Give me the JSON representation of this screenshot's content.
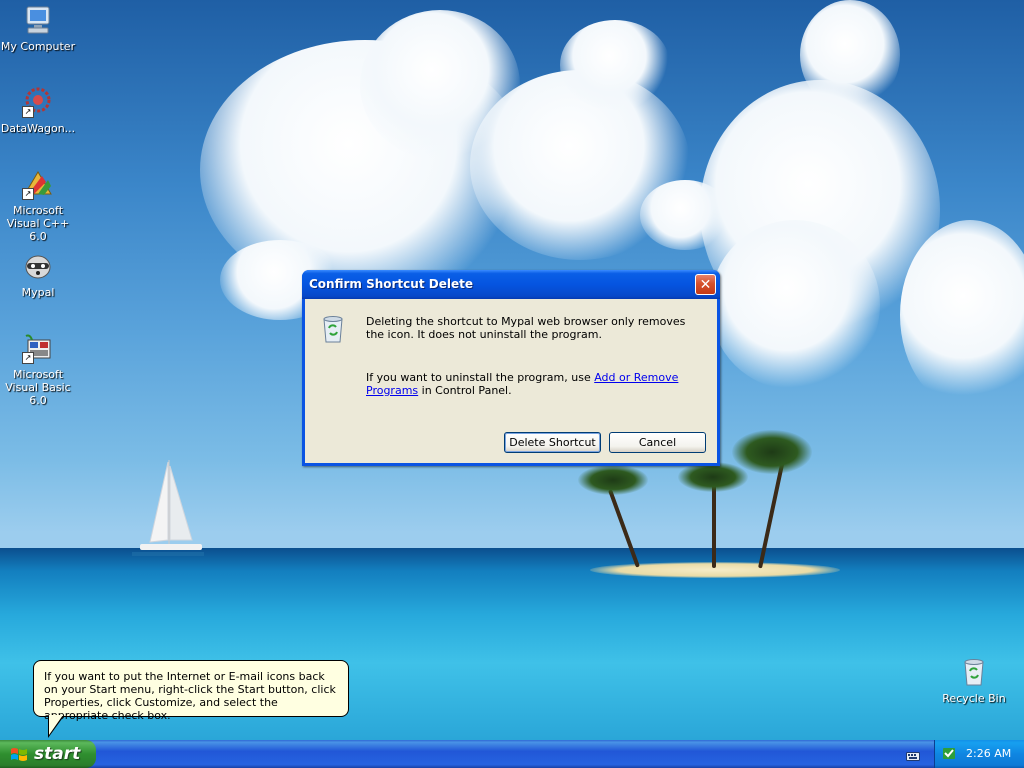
{
  "desktop": {
    "icons": [
      {
        "label": "My Computer",
        "icon": "my-computer-icon"
      },
      {
        "label": "DataWagon...",
        "icon": "datawagon-icon"
      },
      {
        "label": "Microsoft Visual C++ 6.0",
        "icon": "visual-cpp-icon"
      },
      {
        "label": "Mypal",
        "icon": "mypal-icon"
      },
      {
        "label": "Microsoft Visual Basic 6.0",
        "icon": "visual-basic-icon"
      },
      {
        "label": "Recycle Bin",
        "icon": "recycle-bin-icon"
      }
    ]
  },
  "dialog": {
    "title": "Confirm Shortcut Delete",
    "message_line1": "Deleting the shortcut to Mypal web browser only removes the icon. It does not uninstall the program.",
    "message_line2_before": "If you want to uninstall the program, use ",
    "message_line2_link": "Add or Remove Programs",
    "message_line2_after": " in Control Panel.",
    "primary_button": "Delete Shortcut",
    "cancel_button": "Cancel",
    "close_glyph": "✕"
  },
  "balloon": {
    "text": "If you want to put the Internet or E-mail icons back on your Start menu, right-click the Start button, click Properties, click Customize, and select the appropriate check box."
  },
  "taskbar": {
    "start_label": "start",
    "clock": "2:26 AM"
  },
  "colors": {
    "titlebar": "#0554e0",
    "dialog_body": "#ece9d8",
    "start_green": "#2f8f2f",
    "taskbar_blue": "#2157d7",
    "tray_blue": "#0f86e2",
    "balloon_bg": "#ffffe1"
  }
}
